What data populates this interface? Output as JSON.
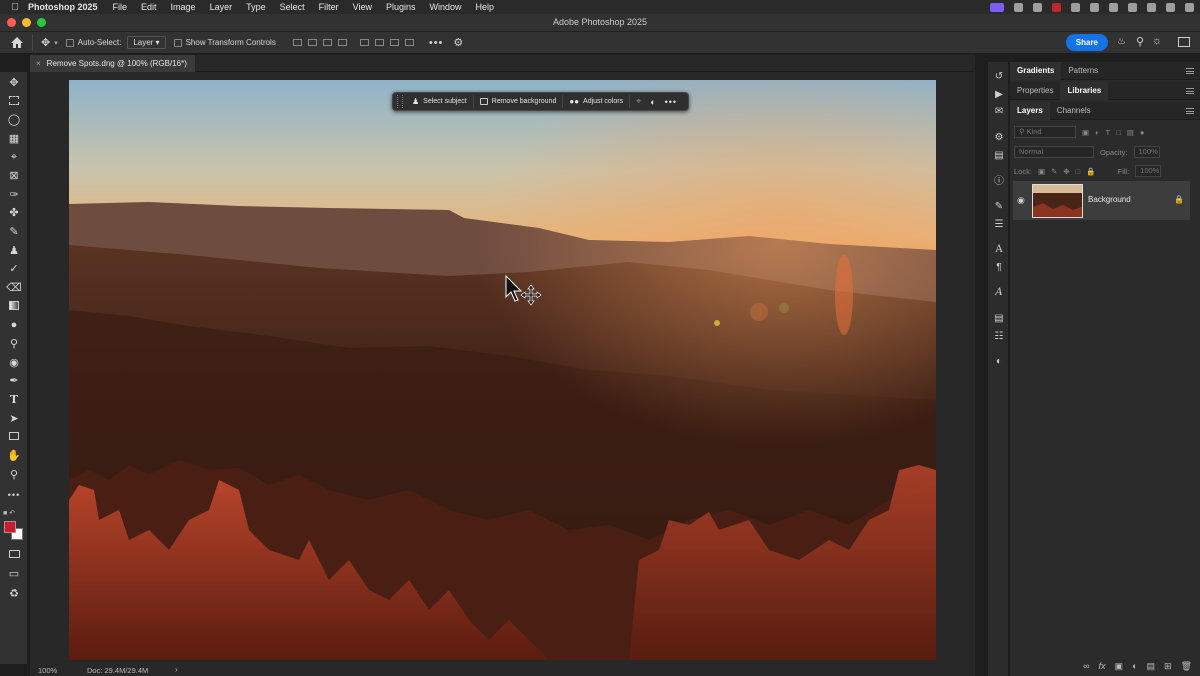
{
  "menubar": {
    "app": "Photoshop 2025",
    "items": [
      "File",
      "Edit",
      "Image",
      "Layer",
      "Type",
      "Select",
      "Filter",
      "View",
      "Plugins",
      "Window",
      "Help"
    ]
  },
  "window": {
    "title": "Adobe Photoshop 2025"
  },
  "options": {
    "auto_select_label": "Auto-Select:",
    "auto_select_value": "Layer",
    "transform_label": "Show Transform Controls",
    "share_label": "Share"
  },
  "document": {
    "tab_title": "Remove Spots.dng @ 100% (RGB/16*)",
    "zoom": "100%",
    "doc_info": "Doc: 29.4M/29.4M"
  },
  "taskbar": {
    "select_subject": "Select subject",
    "remove_background": "Remove background",
    "adjust_colors": "Adjust colors"
  },
  "panels": {
    "top_tabs": [
      "Gradients",
      "Patterns"
    ],
    "mid_tabs": [
      "Properties",
      "Libraries"
    ],
    "layer_tabs": [
      "Layers",
      "Channels"
    ],
    "kind_placeholder": "Kind",
    "blend_mode": "Normal",
    "opacity_label": "Opacity:",
    "opacity_value": "100%",
    "lock_label": "Lock:",
    "fill_label": "Fill:",
    "fill_value": "100%"
  },
  "layers": [
    {
      "name": "Background"
    }
  ],
  "colors": {
    "accent": "#1473e6",
    "foreground": "#d0182c",
    "background": "#ffffff"
  }
}
